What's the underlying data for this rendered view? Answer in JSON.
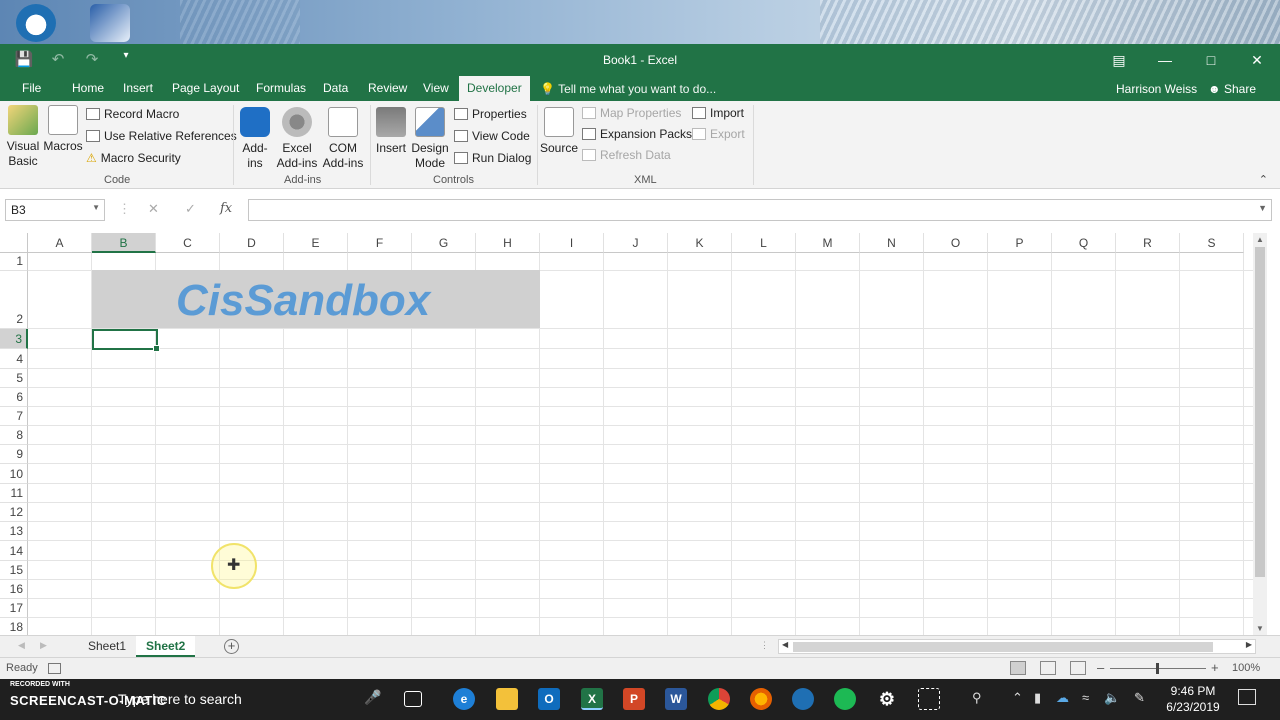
{
  "window": {
    "title": "Book1 - Excel"
  },
  "titlebar": {
    "save_icon": "save-icon",
    "undo_icon": "undo-icon",
    "redo_icon": "redo-icon",
    "customize_icon": "customize-qat-icon"
  },
  "tabs": [
    "File",
    "Home",
    "Insert",
    "Page Layout",
    "Formulas",
    "Data",
    "Review",
    "View",
    "Developer"
  ],
  "active_tab": "Developer",
  "tell_me": "Tell me what you want to do...",
  "user": "Harrison Weiss",
  "share": "Share",
  "ribbon": {
    "code": {
      "label": "Code",
      "visual_basic": "Visual Basic",
      "macros": "Macros",
      "record_macro": "Record Macro",
      "use_relative": "Use Relative References",
      "macro_security": "Macro Security"
    },
    "addins": {
      "label": "Add-ins",
      "addins": "Add-ins",
      "excel_addins": "Excel Add-ins",
      "com_addins": "COM Add-ins"
    },
    "controls": {
      "label": "Controls",
      "insert": "Insert",
      "design_mode": "Design Mode",
      "properties": "Properties",
      "view_code": "View Code",
      "run_dialog": "Run Dialog"
    },
    "xml": {
      "label": "XML",
      "source": "Source",
      "map_properties": "Map Properties",
      "expansion_packs": "Expansion Packs",
      "refresh_data": "Refresh Data",
      "import": "Import",
      "export": "Export"
    }
  },
  "formula_bar": {
    "name_box": "B3",
    "fx": "fx",
    "value": ""
  },
  "grid": {
    "columns": [
      "A",
      "B",
      "C",
      "D",
      "E",
      "F",
      "G",
      "H",
      "I",
      "J",
      "K",
      "L",
      "M",
      "N",
      "O",
      "P",
      "Q",
      "R",
      "S"
    ],
    "rows": [
      "1",
      "2",
      "3",
      "4",
      "5",
      "6",
      "7",
      "8",
      "9",
      "10",
      "11",
      "12",
      "13",
      "14",
      "15",
      "16",
      "17",
      "18"
    ],
    "banner_text": "CisSandbox",
    "banner_color": "#5b9bd5",
    "selected_cell": "B3"
  },
  "sheets": [
    "Sheet1",
    "Sheet2"
  ],
  "active_sheet": "Sheet2",
  "status": {
    "ready": "Ready",
    "zoom": "100%"
  },
  "taskbar": {
    "recorded_with": "RECORDED WITH",
    "screencast": "SCREENCAST-O-MATIC",
    "search_placeholder": "Type here to search",
    "time": "9:46 PM",
    "date": "6/23/2019"
  },
  "colors": {
    "excel_green": "#217346",
    "ribbon_bg": "#f3f3f3",
    "taskbar_bg": "#1f1f1f"
  }
}
